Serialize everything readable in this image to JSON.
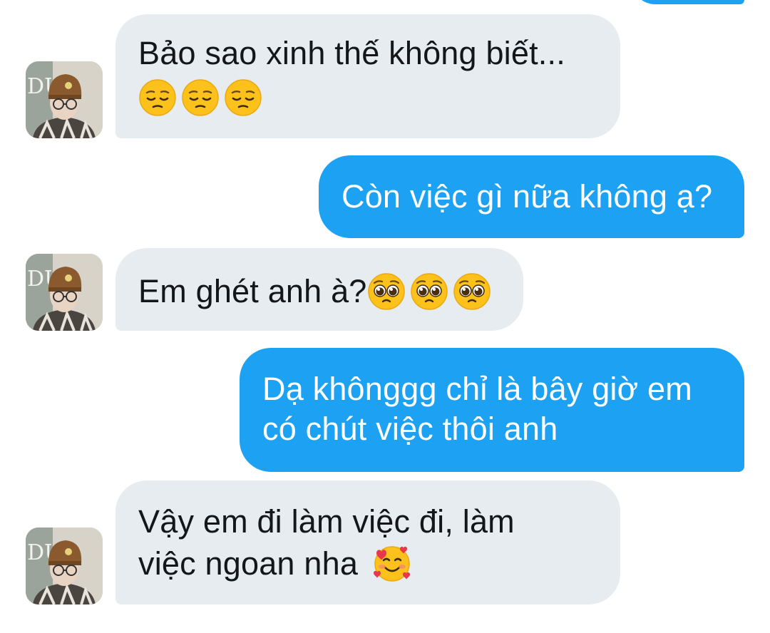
{
  "messages": [
    {
      "direction": "incoming",
      "text": "Bảo sao xinh thế không biết...",
      "emoji": [
        "pensive-face",
        "pensive-face",
        "pensive-face"
      ]
    },
    {
      "direction": "outgoing",
      "text": "Còn việc gì nữa không ạ?"
    },
    {
      "direction": "incoming",
      "text": "Em ghét anh à?",
      "emoji": [
        "pleading-face",
        "pleading-face",
        "pleading-face"
      ]
    },
    {
      "direction": "outgoing",
      "lines": [
        "Dạ khônggg chỉ là bây giờ em",
        "có chút việc thôi anh"
      ]
    },
    {
      "direction": "incoming",
      "lines": [
        "Vậy em đi làm việc đi, làm",
        "việc ngoan nha"
      ],
      "emoji": [
        "smiling-face-with-hearts"
      ]
    }
  ],
  "colors": {
    "incoming_bubble": "#e6ecf0",
    "incoming_text": "#14171a",
    "outgoing_bubble": "#1da1f2",
    "outgoing_text": "#ffffff"
  },
  "icons": {
    "avatar": "user-avatar-photo"
  }
}
